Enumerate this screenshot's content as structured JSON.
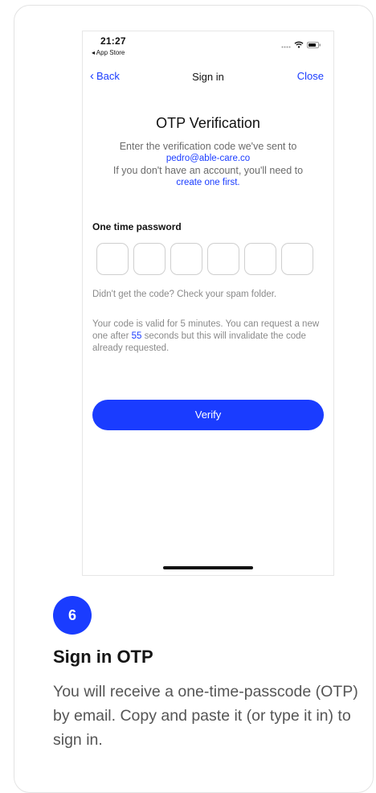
{
  "status_bar": {
    "time": "21:27",
    "back_app": "◂ App Store",
    "icons": [
      "signal-icon",
      "wifi-icon",
      "battery-icon"
    ]
  },
  "nav": {
    "back_label": "Back",
    "title": "Sign in",
    "close_label": "Close"
  },
  "otp": {
    "title": "OTP Verification",
    "line1": "Enter the verification code we've sent to",
    "email": "pedro@able-care.co",
    "line2": "If you don't have an account, you'll need to",
    "create_link": "create one first.",
    "field_label": "One time password",
    "box_count": 6,
    "spam_text": "Didn't get the code? Check your spam folder.",
    "valid_before": "Your code is valid for 5 minutes.  You can request a new one after ",
    "seconds": "55",
    "valid_after": " seconds but this will invalidate the code already requested.",
    "verify_label": "Verify"
  },
  "step": {
    "number": "6",
    "title": "Sign in OTP",
    "description": "You will receive a one-time-passcode (OTP) by email. Copy and paste it (or type it in) to sign in."
  },
  "colors": {
    "accent": "#1a3cff",
    "muted_text": "#8a8a8a",
    "border": "#cfcfcf"
  }
}
